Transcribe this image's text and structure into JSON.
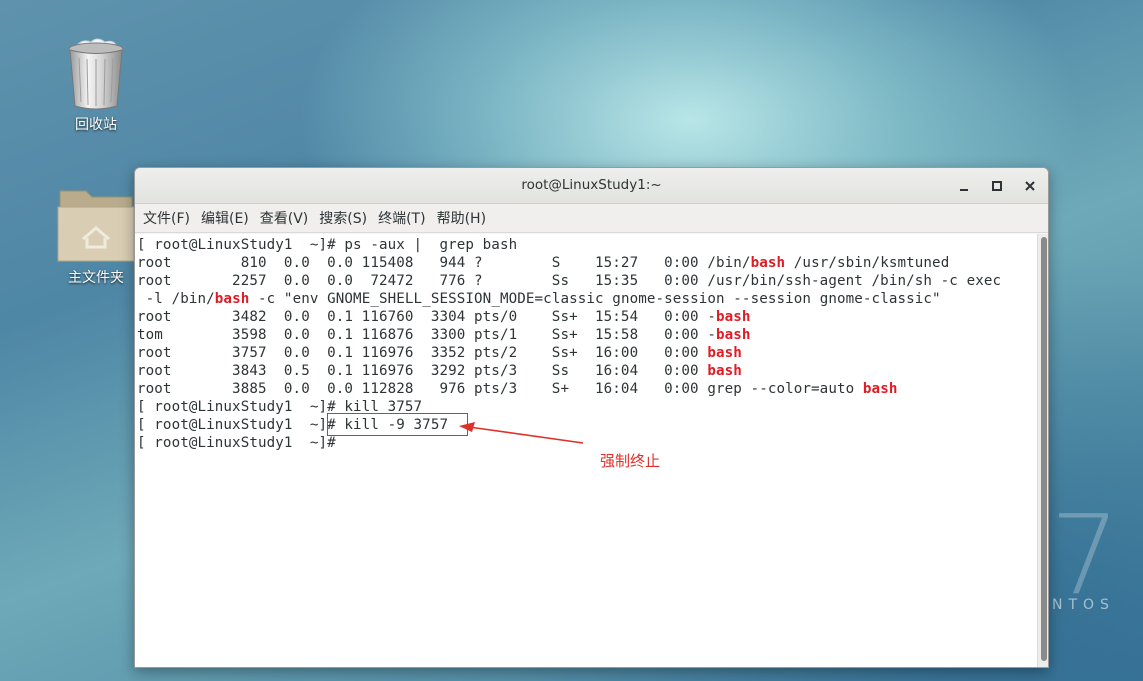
{
  "desktop": {
    "icons": [
      {
        "name": "trash",
        "label": "回收站"
      },
      {
        "name": "home",
        "label": "主文件夹"
      }
    ],
    "watermark_numeral": "7",
    "watermark_text": "NTOS"
  },
  "window": {
    "title": "root@LinuxStudy1:~",
    "buttons": {
      "minimize": "minimize-icon",
      "maximize": "maximize-icon",
      "close": "close-icon"
    }
  },
  "menu": [
    "文件(F)",
    "编辑(E)",
    "查看(V)",
    "搜索(S)",
    "终端(T)",
    "帮助(H)"
  ],
  "terminal": {
    "lines": [
      [
        {
          "t": "[ root@LinuxStudy1  ~]# ps -aux |  grep bash"
        }
      ],
      [
        {
          "t": "root        810  0.0  0.0 115408   944 ?        S    15:27   0:00 /bin/"
        },
        {
          "t": "bash",
          "hl": true
        },
        {
          "t": " /usr/sbin/ksmtuned"
        }
      ],
      [
        {
          "t": "root       2257  0.0  0.0  72472   776 ?        Ss   15:35   0:00 /usr/bin/ssh-agent /bin/sh -c exec"
        }
      ],
      [
        {
          "t": " -l /bin/"
        },
        {
          "t": "bash",
          "hl": true
        },
        {
          "t": " -c \"env GNOME_SHELL_SESSION_MODE=classic gnome-session --session gnome-classic\""
        }
      ],
      [
        {
          "t": "root       3482  0.0  0.1 116760  3304 pts/0    Ss+  15:54   0:00 -"
        },
        {
          "t": "bash",
          "hl": true
        }
      ],
      [
        {
          "t": "tom        3598  0.0  0.1 116876  3300 pts/1    Ss+  15:58   0:00 -"
        },
        {
          "t": "bash",
          "hl": true
        }
      ],
      [
        {
          "t": "root       3757  0.0  0.1 116976  3352 pts/2    Ss+  16:00   0:00 "
        },
        {
          "t": "bash",
          "hl": true
        }
      ],
      [
        {
          "t": "root       3843  0.5  0.1 116976  3292 pts/3    Ss   16:04   0:00 "
        },
        {
          "t": "bash",
          "hl": true
        }
      ],
      [
        {
          "t": "root       3885  0.0  0.0 112828   976 pts/3    S+   16:04   0:00 grep --color=auto "
        },
        {
          "t": "bash",
          "hl": true
        }
      ],
      [
        {
          "t": "[ root@LinuxStudy1  ~]# kill 3757"
        }
      ],
      [
        {
          "t": "[ root@LinuxStudy1  ~]# kill -9 3757"
        }
      ],
      [
        {
          "t": "[ root@LinuxStudy1  ~]#"
        }
      ]
    ]
  },
  "annotation": {
    "label": "强制终止",
    "color": "#e0302a"
  }
}
